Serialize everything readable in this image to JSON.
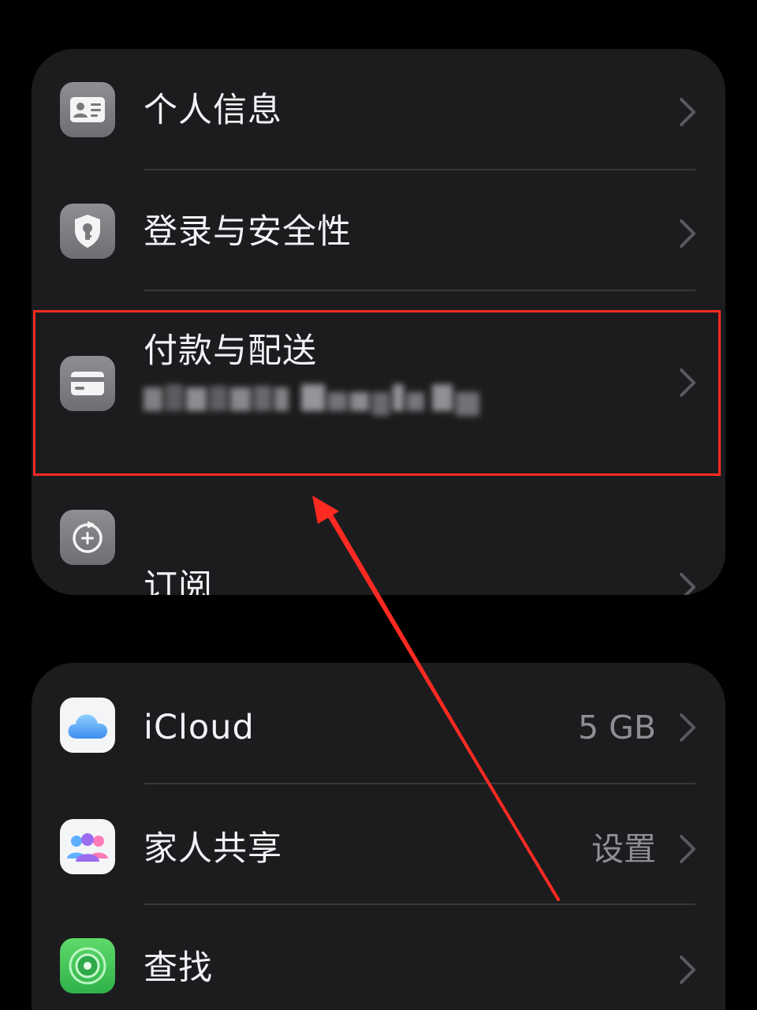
{
  "account_group": {
    "items": [
      {
        "label": "个人信息",
        "icon": "contact-card-icon"
      },
      {
        "label": "登录与安全性",
        "icon": "shield-key-icon"
      },
      {
        "label": "付款与配送",
        "sublabel_redacted": true,
        "icon": "credit-card-icon"
      },
      {
        "label": "订阅",
        "icon": "subscription-plus-icon"
      }
    ]
  },
  "services_group": {
    "items": [
      {
        "label": "iCloud",
        "value": "5 GB",
        "icon": "icloud-icon"
      },
      {
        "label": "家人共享",
        "value": "设置",
        "icon": "family-sharing-icon"
      },
      {
        "label": "查找",
        "icon": "find-my-icon"
      }
    ]
  },
  "colors": {
    "background": "#000000",
    "group_background": "#1c1c1e",
    "separator": "#38383a",
    "primary_text": "#f2f2f7",
    "secondary_text": "#8e8e93",
    "annotation_red": "#ff2a22"
  }
}
